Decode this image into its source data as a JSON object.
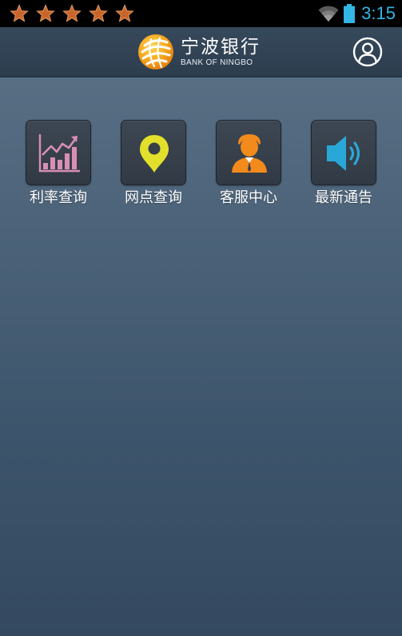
{
  "status_bar": {
    "time": "3:15",
    "time_color": "#33b5e5",
    "notification_icons": [
      "star-icon",
      "star-icon",
      "star-icon",
      "star-icon",
      "star-icon"
    ],
    "system_icons": [
      "wifi-icon",
      "battery-icon"
    ]
  },
  "header": {
    "brand_name": "宁波银行",
    "brand_name_en": "BANK OF NINGBO",
    "logo_icon": "bank-of-ningbo-logo",
    "profile_icon": "user-profile-icon"
  },
  "menu": {
    "items": [
      {
        "label": "利率查询",
        "icon": "rate-chart-icon",
        "icon_color": "#d98fb5"
      },
      {
        "label": "网点查询",
        "icon": "location-pin-icon",
        "icon_color": "#e3e02c"
      },
      {
        "label": "客服中心",
        "icon": "customer-service-icon",
        "icon_color": "#f28a1c"
      },
      {
        "label": "最新通告",
        "icon": "speaker-icon",
        "icon_color": "#29a8d8"
      }
    ]
  },
  "colors": {
    "status_bar_bg": "#000000",
    "header_bg": "#2f4152",
    "background_top": "#5f7489",
    "background_bottom": "#34495f",
    "star_color": "#c9652b"
  }
}
